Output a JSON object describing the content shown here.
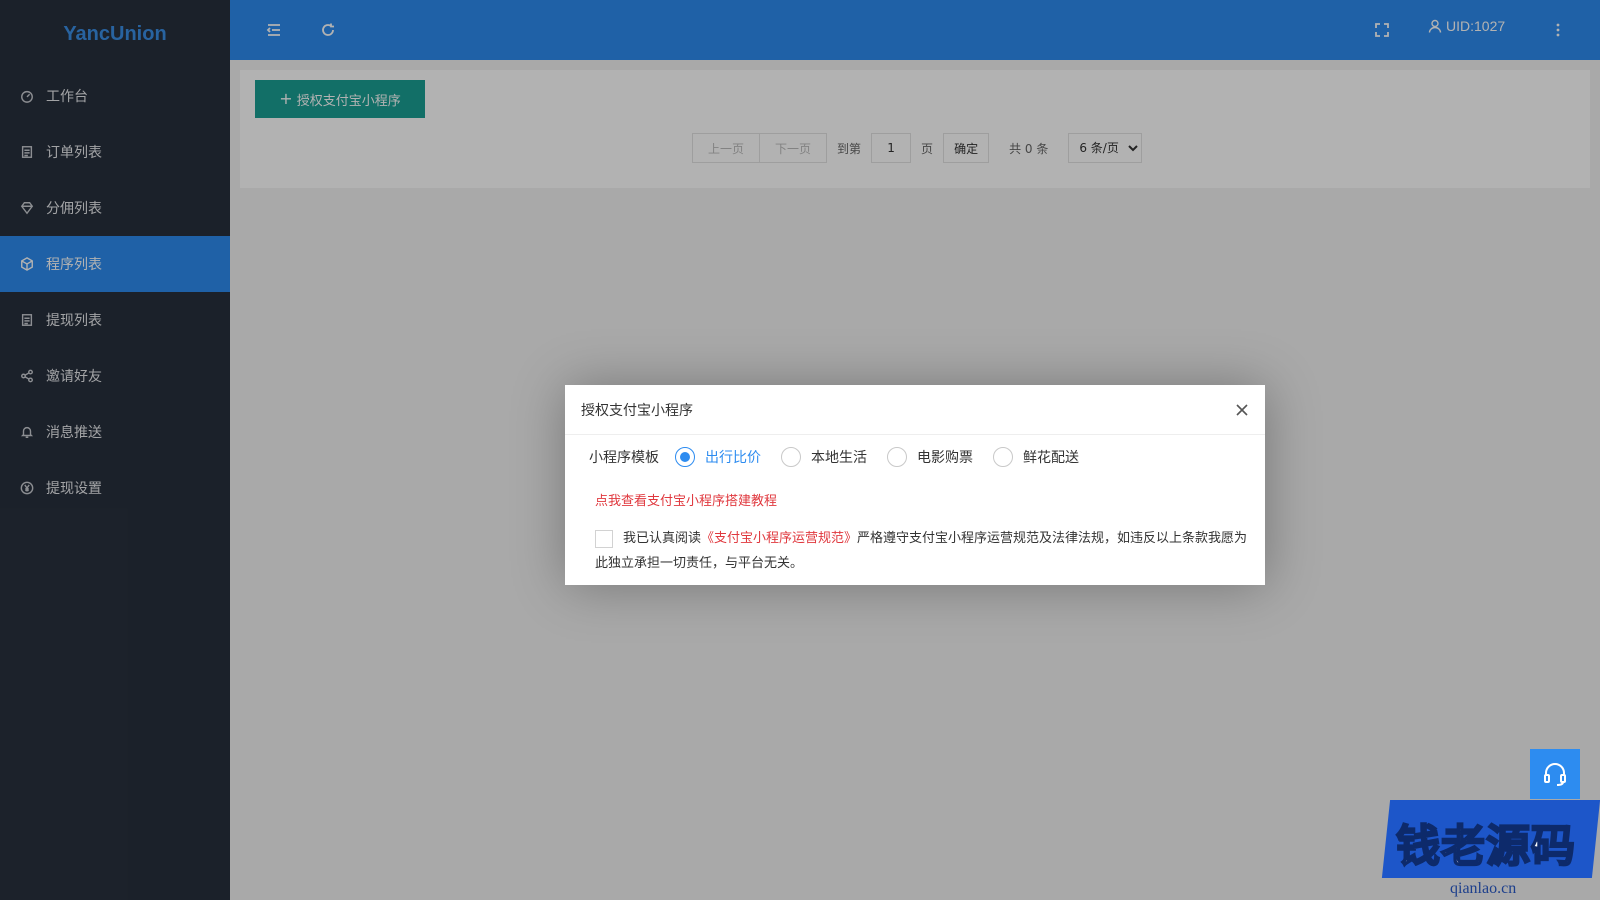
{
  "app": {
    "logo": "YancUnion"
  },
  "sidebar": {
    "items": [
      {
        "label": "工作台",
        "icon": "dashboard-icon",
        "active": false
      },
      {
        "label": "订单列表",
        "icon": "document-icon",
        "active": false
      },
      {
        "label": "分佣列表",
        "icon": "diamond-icon",
        "active": false
      },
      {
        "label": "程序列表",
        "icon": "box-icon",
        "active": true
      },
      {
        "label": "提现列表",
        "icon": "document-icon",
        "active": false
      },
      {
        "label": "邀请好友",
        "icon": "share-icon",
        "active": false
      },
      {
        "label": "消息推送",
        "icon": "bell-icon",
        "active": false
      },
      {
        "label": "提现设置",
        "icon": "yen-icon",
        "active": false
      }
    ]
  },
  "header": {
    "uid": "UID:1027"
  },
  "toolbar": {
    "add_label": "授权支付宝小程序"
  },
  "pager": {
    "prev": "上一页",
    "next": "下一页",
    "goto": "到第",
    "page_value": "1",
    "page_unit": "页",
    "confirm": "确定",
    "total": "共 0 条",
    "per_page": "6 条/页"
  },
  "dialog": {
    "title": "授权支付宝小程序",
    "template_label": "小程序模板",
    "options": [
      {
        "label": "出行比价",
        "selected": true
      },
      {
        "label": "本地生活",
        "selected": false
      },
      {
        "label": "电影购票",
        "selected": false
      },
      {
        "label": "鲜花配送",
        "selected": false
      }
    ],
    "tutorial_link": "点我查看支付宝小程序搭建教程",
    "agree_prefix": "我已认真阅读",
    "agree_link": "《支付宝小程序运营规范》",
    "agree_suffix": "严格遵守支付宝小程序运营规范及法律法规，如违反以上条款我愿为此独立承担一切责任，与平台无关。"
  },
  "watermark": {
    "text": "钱老源码",
    "domain": "qianlao.cn"
  },
  "colors": {
    "primary": "#2d8cf0",
    "sidebar": "#28303d",
    "teal": "#1aa094",
    "danger": "#e0383e"
  }
}
